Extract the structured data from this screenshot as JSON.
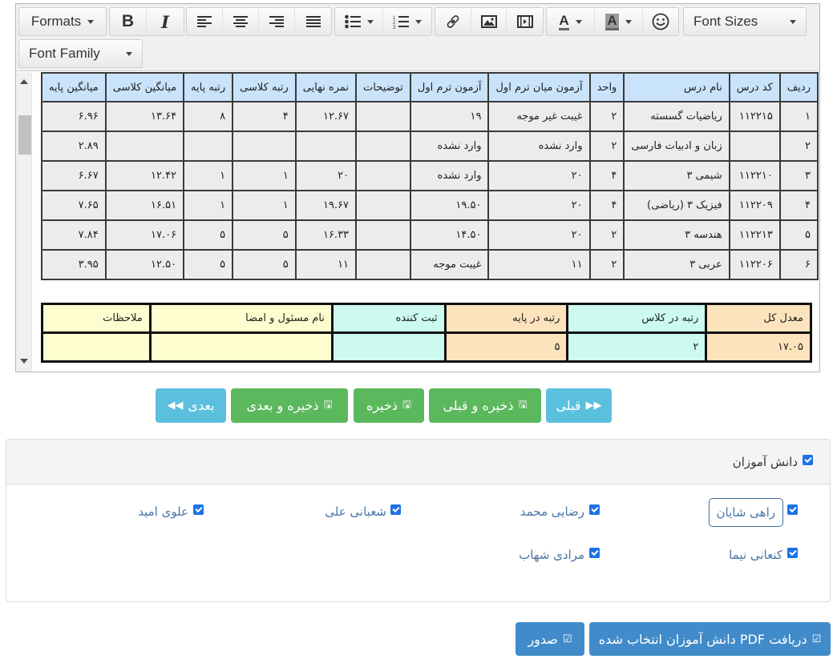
{
  "toolbar": {
    "formats": "Formats",
    "font_sizes": "Font Sizes",
    "font_family": "Font Family",
    "icons": [
      "bold-icon",
      "italic-icon",
      "align-left-icon",
      "align-center-icon",
      "align-right-icon",
      "align-justify-icon",
      "bullet-list-icon",
      "numbered-list-icon",
      "link-icon",
      "image-icon",
      "media-icon",
      "text-color-icon",
      "background-color-icon",
      "emoticon-icon"
    ],
    "bold_glyph": "B",
    "italic_glyph": "I",
    "color_glyph": "A"
  },
  "grades_table": {
    "headers": [
      "ردیف",
      "کد درس",
      "نام درس",
      "واحد",
      "آزمون میان ترم اول",
      "آزمون ترم اول",
      "توضیحات",
      "نمره نهایی",
      "رتبه کلاسی",
      "رتبه پایه",
      "میانگین کلاسی",
      "میانگین پایه"
    ],
    "rows": [
      [
        "۱",
        "۱۱۲۲۱۵",
        "ریاضیات گسسته",
        "۲",
        "غیبت غیر موجه",
        "۱۹",
        "",
        "۱۲.۶۷",
        "۴",
        "۸",
        "۱۳.۶۴",
        "۶.۹۶"
      ],
      [
        "۲",
        "",
        "زبان و ادبیات فارسی",
        "۲",
        "وارد نشده",
        "وارد نشده",
        "",
        "",
        "",
        "",
        "",
        "۲.۸۹"
      ],
      [
        "۳",
        "۱۱۲۲۱۰",
        "شیمی ۳",
        "۴",
        "۲۰",
        "وارد نشده",
        "",
        "۲۰",
        "۱",
        "۱",
        "۱۲.۴۲",
        "۶.۶۷"
      ],
      [
        "۴",
        "۱۱۲۲۰۹",
        "فیزیک ۳ (ریاضی)",
        "۴",
        "۲۰",
        "۱۹.۵۰",
        "",
        "۱۹.۶۷",
        "۱",
        "۱",
        "۱۶.۵۱",
        "۷.۶۵"
      ],
      [
        "۵",
        "۱۱۲۲۱۳",
        "هندسه ۳",
        "۲",
        "۲۰",
        "۱۴.۵۰",
        "",
        "۱۶.۳۳",
        "۵",
        "۵",
        "۱۷.۰۶",
        "۷.۸۴"
      ],
      [
        "۶",
        "۱۱۲۲۰۶",
        "عربی ۳",
        "۲",
        "۱۱",
        "غیبت موجه",
        "",
        "۱۱",
        "۵",
        "۵",
        "۱۲.۵۰",
        "۳.۹۵"
      ]
    ]
  },
  "summary_table": {
    "headers": [
      "معدل کل",
      "رتبه در کلاس",
      "رتبه در پایه",
      "ثبت کننده",
      "نام مسئول و امضا",
      "ملاحظات"
    ],
    "values": [
      "۱۷.۰۵",
      "۲",
      "۵",
      "",
      "",
      ""
    ],
    "colors": [
      "#fde3bd",
      "#ccfaee",
      "#fde3bd",
      "#ccfaee",
      "#fdfdd0",
      "#fdfdd0"
    ]
  },
  "nav": {
    "prev": "قبلی",
    "save_prev": "ذخیره و قبلی",
    "save": "ذخیره",
    "save_next": "ذخیره و بعدی",
    "next": "بعدی"
  },
  "students_panel": {
    "title": "دانش آموزان",
    "title_checked": true,
    "students": [
      {
        "name": "راهی شایان",
        "checked": true
      },
      {
        "name": "رضایی محمد",
        "checked": true
      },
      {
        "name": "شعبانی علی",
        "checked": true
      },
      {
        "name": "علوی امید",
        "checked": true
      },
      {
        "name": "کنعانی نیما",
        "checked": true
      },
      {
        "name": "مرادی شهاب",
        "checked": true
      }
    ]
  },
  "actions": {
    "download_pdf": "دریافت PDF دانش آموزان انتخاب شده",
    "issue": "صدور"
  },
  "colors": {
    "info": "#5bc0de",
    "success": "#5cb85c",
    "primary": "#428bca",
    "table_header": "#c9e3fb",
    "checkbox": "#1e72e8"
  }
}
